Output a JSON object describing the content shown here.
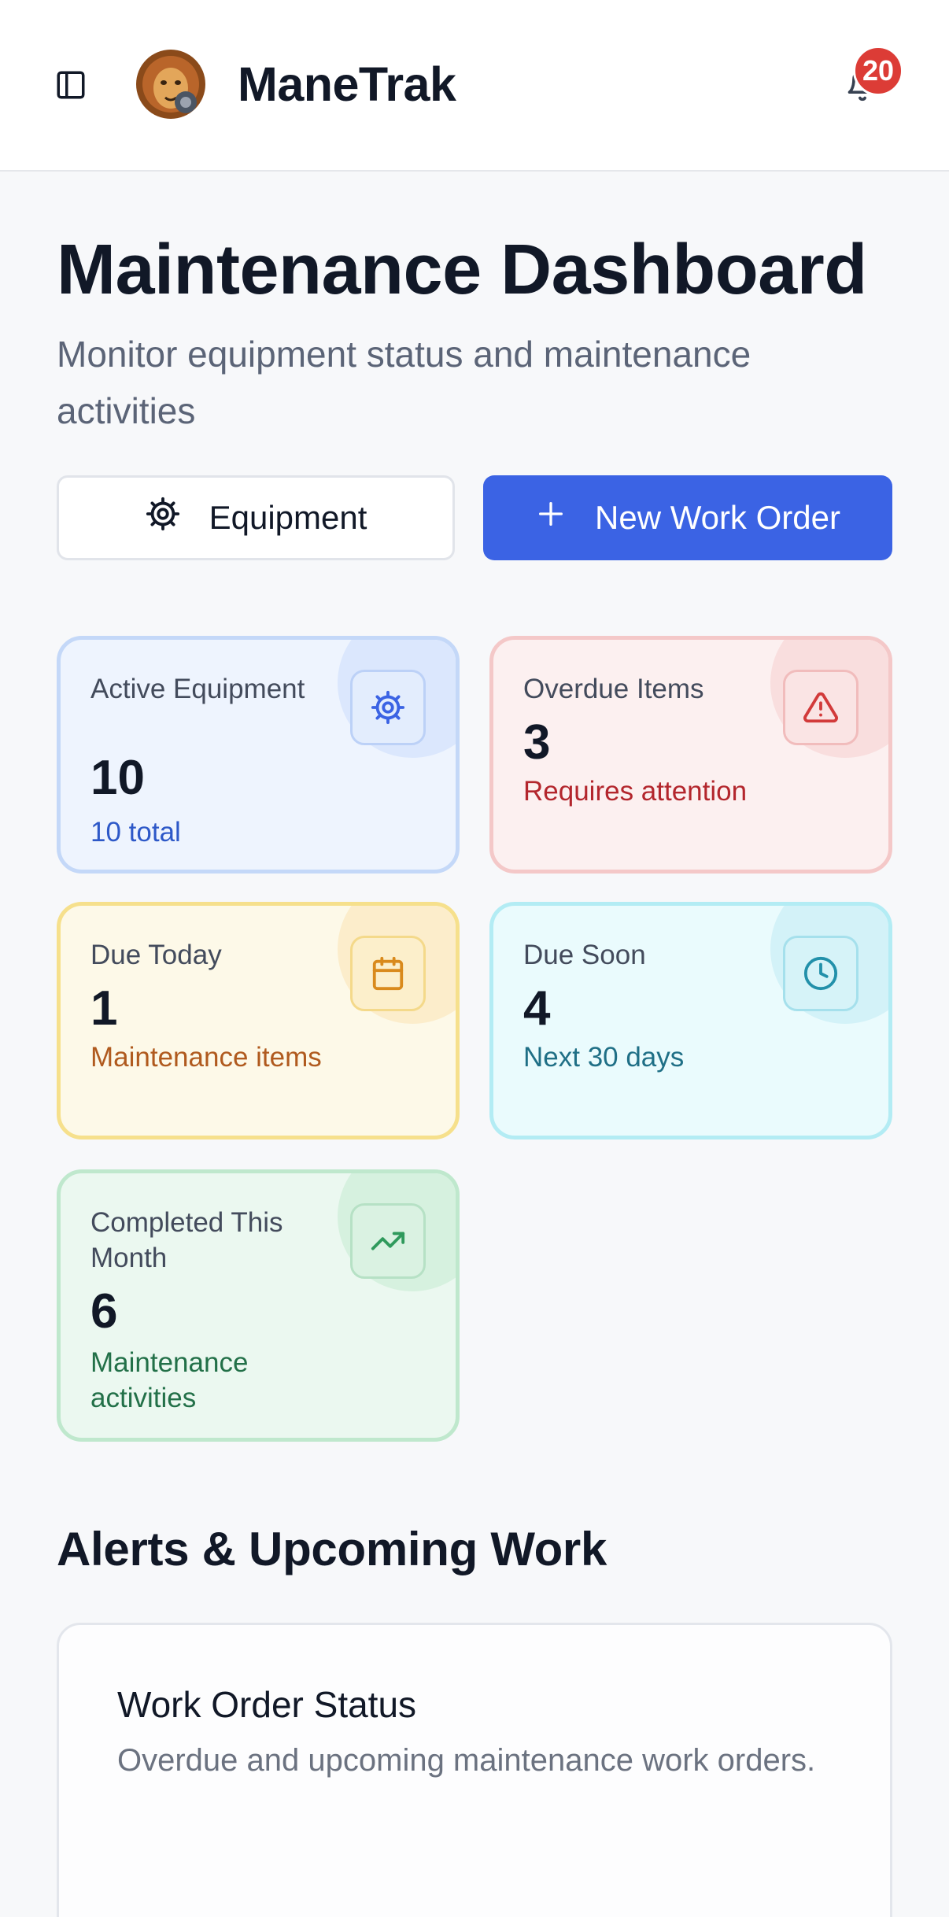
{
  "header": {
    "app_title": "ManeTrak",
    "notification_count": "20"
  },
  "page": {
    "title": "Maintenance Dashboard",
    "subtitle": "Monitor equipment status and maintenance activities"
  },
  "actions": {
    "equipment_label": "Equipment",
    "new_work_order_label": "New Work Order"
  },
  "stats": {
    "active": {
      "label": "Active Equipment",
      "value": "10",
      "note": "10 total",
      "icon": "gear-icon",
      "color": "#3b63e4"
    },
    "overdue": {
      "label": "Overdue Items",
      "value": "3",
      "note": "Requires attention",
      "icon": "alert-triangle-icon",
      "color": "#d23a3a"
    },
    "due_today": {
      "label": "Due Today",
      "value": "1",
      "note": "Maintenance items",
      "icon": "calendar-icon",
      "color": "#d98a1c"
    },
    "due_soon": {
      "label": "Due Soon",
      "value": "4",
      "note": "Next 30 days",
      "icon": "clock-icon",
      "color": "#2290aa"
    },
    "completed": {
      "label": "Completed This Month",
      "value": "6",
      "note": "Maintenance activities",
      "icon": "trending-up-icon",
      "color": "#2f9a5c"
    }
  },
  "alerts": {
    "section_title": "Alerts & Upcoming Work",
    "card_title": "Work Order Status",
    "card_subtitle": "Overdue and upcoming maintenance work orders."
  }
}
